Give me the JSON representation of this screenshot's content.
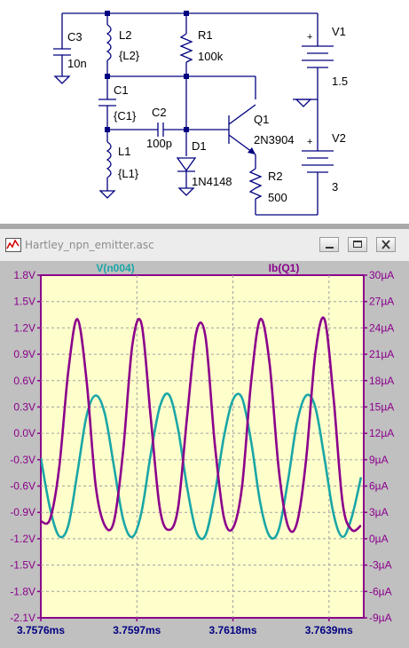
{
  "schematic": {
    "components": {
      "c3": {
        "name": "C3",
        "value": "10n"
      },
      "l2": {
        "name": "L2",
        "value": "{L2}"
      },
      "r1": {
        "name": "R1",
        "value": "100k"
      },
      "v1": {
        "name": "V1",
        "value": "1.5"
      },
      "c1": {
        "name": "C1",
        "value": "{C1}"
      },
      "c2": {
        "name": "C2",
        "value": "100p"
      },
      "q1": {
        "name": "Q1",
        "value": "2N3904"
      },
      "d1": {
        "name": "D1",
        "value": "1N4148"
      },
      "v2": {
        "name": "V2",
        "value": "3"
      },
      "l1": {
        "name": "L1",
        "value": "{L1}"
      },
      "r2": {
        "name": "R2",
        "value": "500"
      }
    },
    "polarity": {
      "plus": "+"
    }
  },
  "window": {
    "title": "Hartley_npn_emitter.asc",
    "minimize_icon": "minimize-icon",
    "restore_icon": "restore-icon",
    "close_icon": "close-icon"
  },
  "colors": {
    "v_trace": "#1aa6a6",
    "ib_trace": "#8b008b",
    "plot_bg": "#ffffcc",
    "frame_bg": "#c0c0c0",
    "axis_text": "#8b008b",
    "xaxis_text": "#000080"
  },
  "chart_data": {
    "type": "line",
    "x": [
      3.7576,
      3.76466
    ],
    "xlim": [
      3.7576,
      3.76466
    ],
    "x_ticks": [
      "3.7576ms",
      "3.7597ms",
      "3.7618ms",
      "3.7639ms"
    ],
    "x_tick_values": [
      3.7576,
      3.7597,
      3.7618,
      3.7639
    ],
    "left_axis": {
      "ylim": [
        -2.1,
        1.8
      ],
      "ticks": [
        "1.8V",
        "1.5V",
        "1.2V",
        "0.9V",
        "0.6V",
        "0.3V",
        "0.0V",
        "-0.3V",
        "-0.6V",
        "-0.9V",
        "-1.2V",
        "-1.5V",
        "-1.8V",
        "-2.1V"
      ],
      "tick_values": [
        1.8,
        1.5,
        1.2,
        0.9,
        0.6,
        0.3,
        0.0,
        -0.3,
        -0.6,
        -0.9,
        -1.2,
        -1.5,
        -1.8,
        -2.1
      ]
    },
    "right_axis": {
      "ylim": [
        -9,
        30
      ],
      "ticks": [
        "30µA",
        "27µA",
        "24µA",
        "21µA",
        "18µA",
        "15µA",
        "12µA",
        "9µA",
        "6µA",
        "3µA",
        "0µA",
        "-3µA",
        "-6µA",
        "-9µA"
      ],
      "tick_values": [
        30,
        27,
        24,
        21,
        18,
        15,
        12,
        9,
        6,
        3,
        0,
        -3,
        -6,
        -9
      ]
    },
    "series": [
      {
        "name": "V(n004)",
        "axis": "left",
        "period_ms": 0.00172,
        "x": [
          3.7576,
          3.7578,
          3.758,
          3.7582,
          3.7584,
          3.7586,
          3.7588,
          3.759,
          3.7592,
          3.7594,
          3.7596,
          3.7598,
          3.76,
          3.7602,
          3.7604,
          3.7606,
          3.7608,
          3.761,
          3.7612,
          3.7614,
          3.7616,
          3.7618,
          3.762,
          3.7622,
          3.7624,
          3.7626,
          3.7628,
          3.763,
          3.7632,
          3.7634,
          3.7636,
          3.7638,
          3.764,
          3.7642,
          3.7644,
          3.7646
        ],
        "values": [
          -0.28,
          -0.85,
          -1.17,
          -1.05,
          -0.45,
          0.2,
          0.43,
          0.22,
          -0.38,
          -0.98,
          -1.18,
          -0.9,
          -0.25,
          0.3,
          0.44,
          0.05,
          -0.62,
          -1.12,
          -1.16,
          -0.7,
          -0.05,
          0.38,
          0.4,
          -0.1,
          -0.8,
          -1.17,
          -1.1,
          -0.55,
          0.12,
          0.43,
          0.3,
          -0.28,
          -0.92,
          -1.18,
          -0.95,
          -0.5
        ]
      },
      {
        "name": "Ib(Q1)",
        "axis": "right",
        "period_ms": 0.00172,
        "x": [
          3.7576,
          3.7578,
          3.758,
          3.7582,
          3.7584,
          3.7586,
          3.7588,
          3.759,
          3.7592,
          3.7594,
          3.7596,
          3.7598,
          3.76,
          3.7602,
          3.7604,
          3.7606,
          3.7608,
          3.761,
          3.7612,
          3.7614,
          3.7616,
          3.7618,
          3.762,
          3.7622,
          3.7624,
          3.7626,
          3.7628,
          3.763,
          3.7632,
          3.7634,
          3.7636,
          3.7638,
          3.764,
          3.7642,
          3.7644,
          3.7646
        ],
        "values": [
          2.0,
          2.2,
          8.0,
          19.0,
          25.0,
          18.0,
          6.0,
          1.5,
          2.0,
          10.0,
          22.0,
          24.5,
          14.0,
          3.5,
          1.0,
          3.5,
          14.0,
          23.5,
          23.0,
          11.0,
          2.5,
          1.2,
          6.0,
          18.0,
          25.0,
          20.0,
          8.0,
          1.5,
          1.8,
          9.0,
          21.0,
          25.0,
          16.0,
          4.0,
          1.0,
          1.5
        ]
      }
    ]
  }
}
